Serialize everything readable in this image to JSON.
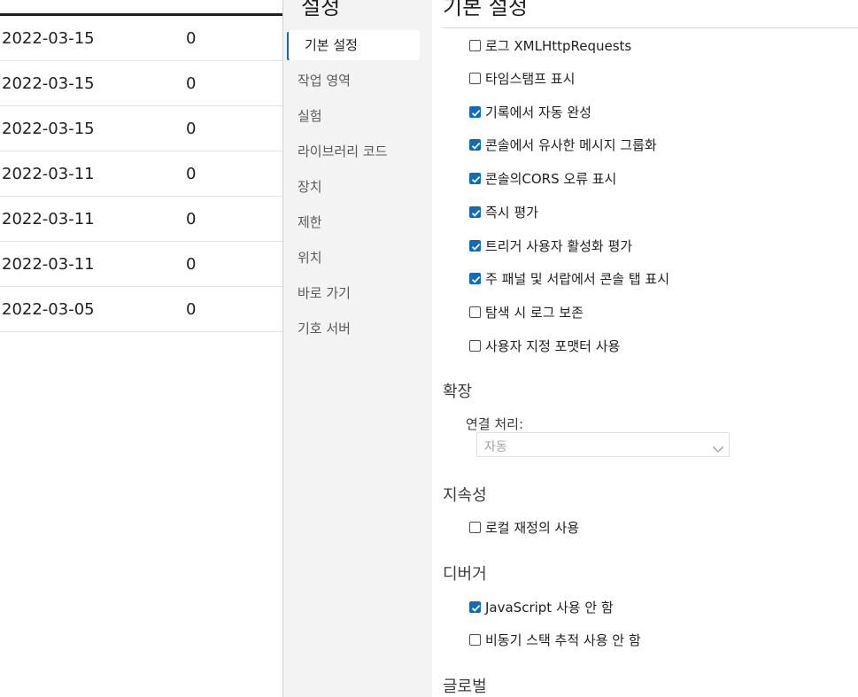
{
  "table": {
    "rows": [
      {
        "date": "2022-03-15",
        "count": "0"
      },
      {
        "date": "2022-03-15",
        "count": "0"
      },
      {
        "date": "2022-03-15",
        "count": "0"
      },
      {
        "date": "2022-03-11",
        "count": "0"
      },
      {
        "date": "2022-03-11",
        "count": "0"
      },
      {
        "date": "2022-03-11",
        "count": "0"
      },
      {
        "date": "2022-03-05",
        "count": "0"
      }
    ]
  },
  "nav": {
    "title": "설정",
    "items": [
      {
        "label": "기본 설정",
        "active": true
      },
      {
        "label": "작업 영역"
      },
      {
        "label": "실험"
      },
      {
        "label": "라이브러리 코드"
      },
      {
        "label": "장치"
      },
      {
        "label": "제한"
      },
      {
        "label": "위치"
      },
      {
        "label": "바로 가기"
      },
      {
        "label": "기호 서버"
      }
    ]
  },
  "main": {
    "title": "기본 설정",
    "console_options": [
      {
        "label": "로그 XMLHttpRequests",
        "checked": false
      },
      {
        "label": "타임스탬프 표시",
        "checked": false
      },
      {
        "label": "기록에서 자동 완성",
        "checked": true
      },
      {
        "label": "콘솔에서 유사한 메시지 그룹화",
        "checked": true
      },
      {
        "label": "콘솔의CORS 오류 표시",
        "checked": true
      },
      {
        "label": "즉시 평가",
        "checked": true
      },
      {
        "label": "트리거 사용자 활성화 평가",
        "checked": true
      },
      {
        "label": "주 패널 및 서랍에서 콘솔 탭 표시",
        "checked": true
      },
      {
        "label": "탐색 시 로그 보존",
        "checked": false
      },
      {
        "label": "사용자 지정 포맷터 사용",
        "checked": false
      }
    ],
    "extensions": {
      "heading": "확장",
      "link_label": "연결 처리:",
      "link_value": "자동"
    },
    "persistence": {
      "heading": "지속성",
      "options": [
        {
          "label": "로컬 재정의 사용",
          "checked": false
        }
      ]
    },
    "debugger": {
      "heading": "디버거",
      "options": [
        {
          "label": "JavaScript 사용 안 함",
          "checked": true
        },
        {
          "label": "비동기 스택 추적 사용 안 함",
          "checked": false
        }
      ]
    },
    "global_heading": "글로벌"
  },
  "colors": {
    "accent": "#0f6cbd",
    "nav_bg": "#f3f3f3"
  }
}
